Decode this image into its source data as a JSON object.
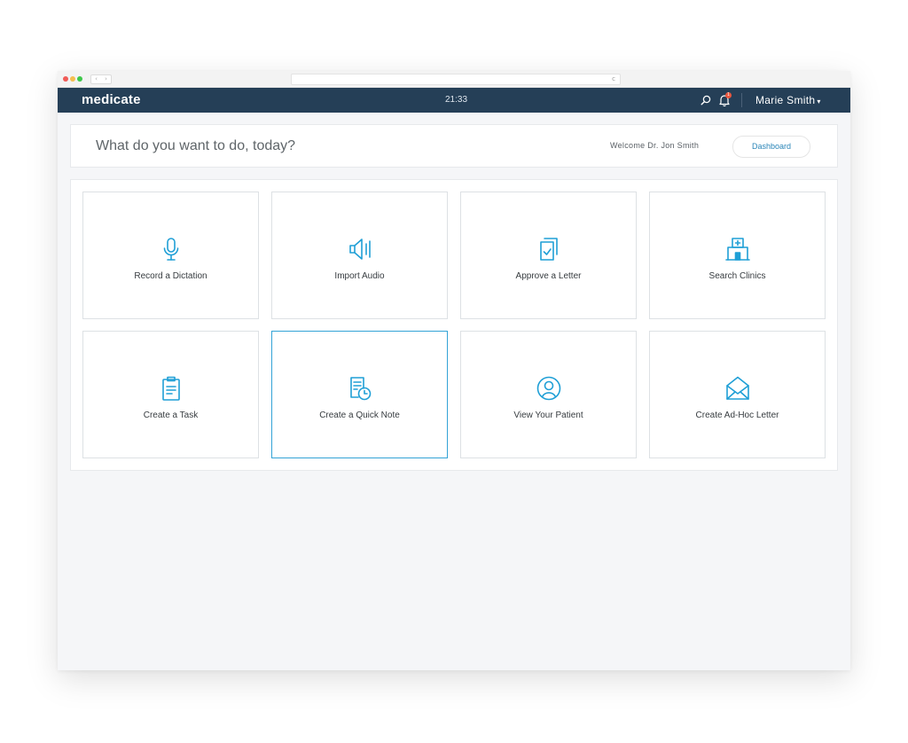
{
  "browser": {
    "reload_glyph": "c",
    "back_glyph": "‹",
    "forward_glyph": "›"
  },
  "header": {
    "logo": "medicate",
    "time": "21:33",
    "notification_count": "1",
    "user_name": "Marie Smith",
    "user_caret": "▾"
  },
  "intro": {
    "title": "What do you want to do, today?",
    "welcome": "Welcome Dr. Jon Smith",
    "dashboard_label": "Dashboard"
  },
  "actions": [
    {
      "label": "Record a Dictation",
      "icon": "microphone-icon"
    },
    {
      "label": "Import Audio",
      "icon": "speaker-icon"
    },
    {
      "label": "Approve a Letter",
      "icon": "document-check-icon"
    },
    {
      "label": "Search Clinics",
      "icon": "hospital-icon"
    },
    {
      "label": "Create a Task",
      "icon": "clipboard-icon"
    },
    {
      "label": "Create a Quick Note",
      "icon": "note-clock-icon",
      "selected": true
    },
    {
      "label": "View Your Patient",
      "icon": "user-circle-icon"
    },
    {
      "label": "Create Ad-Hoc Letter",
      "icon": "envelope-icon"
    }
  ],
  "colors": {
    "header_bg": "#253f57",
    "accent": "#1f9fd6",
    "notification_badge": "#e9573f",
    "page_bg": "#f5f6f8"
  }
}
